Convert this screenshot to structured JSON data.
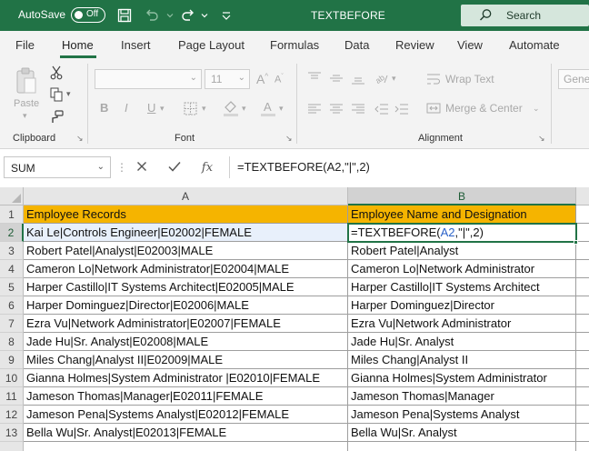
{
  "titlebar": {
    "autosave_label": "AutoSave",
    "autosave_state": "Off",
    "document_title": "TEXTBEFORE",
    "search_placeholder": "Search"
  },
  "ribbon_tabs": [
    "File",
    "Home",
    "Insert",
    "Page Layout",
    "Formulas",
    "Data",
    "Review",
    "View",
    "Automate"
  ],
  "active_tab": "Home",
  "ribbon": {
    "clipboard": {
      "label": "Clipboard",
      "paste_label": "Paste"
    },
    "font": {
      "label": "Font",
      "size": "11",
      "bold": "B",
      "italic": "I",
      "underline": "U"
    },
    "alignment": {
      "label": "Alignment",
      "wrap_text": "Wrap Text",
      "merge_center": "Merge & Center"
    },
    "number": {
      "format": "Genera"
    }
  },
  "formula_bar": {
    "name_box": "SUM",
    "cancel_icon": "x-icon",
    "enter_icon": "check-icon",
    "fx_label": "fx",
    "formula": "=TEXTBEFORE(A2,\"|\",2)"
  },
  "grid": {
    "columns": [
      "A",
      "B"
    ],
    "rows": [
      {
        "num": "1",
        "a": "Employee Records",
        "b": "Employee Name and Designation"
      },
      {
        "num": "2",
        "a": "Kai Le|Controls Engineer|E02002|FEMALE",
        "b_prefix": "=TEXTBEFORE(",
        "b_ref": "A2",
        "b_suffix": ",\"|\",2)"
      },
      {
        "num": "3",
        "a": "Robert Patel|Analyst|E02003|MALE",
        "b": "Robert Patel|Analyst"
      },
      {
        "num": "4",
        "a": "Cameron Lo|Network Administrator|E02004|MALE",
        "b": "Cameron Lo|Network Administrator"
      },
      {
        "num": "5",
        "a": "Harper Castillo|IT Systems Architect|E02005|MALE",
        "b": "Harper Castillo|IT Systems Architect"
      },
      {
        "num": "6",
        "a": "Harper Dominguez|Director|E02006|MALE",
        "b": "Harper Dominguez|Director"
      },
      {
        "num": "7",
        "a": "Ezra Vu|Network Administrator|E02007|FEMALE",
        "b": "Ezra Vu|Network Administrator"
      },
      {
        "num": "8",
        "a": "Jade Hu|Sr. Analyst|E02008|MALE",
        "b": "Jade Hu|Sr. Analyst"
      },
      {
        "num": "9",
        "a": "Miles Chang|Analyst II|E02009|MALE",
        "b": "Miles Chang|Analyst II"
      },
      {
        "num": "10",
        "a": "Gianna Holmes|System Administrator |E02010|FEMALE",
        "b": "Gianna Holmes|System Administrator"
      },
      {
        "num": "11",
        "a": "Jameson Thomas|Manager|E02011|FEMALE",
        "b": "Jameson Thomas|Manager"
      },
      {
        "num": "12",
        "a": "Jameson Pena|Systems Analyst|E02012|FEMALE",
        "b": "Jameson Pena|Systems Analyst"
      },
      {
        "num": "13",
        "a": "Bella Wu|Sr. Analyst|E02013|FEMALE",
        "b": "Bella Wu|Sr. Analyst"
      }
    ]
  },
  "colors": {
    "excel_green": "#217346",
    "header_fill": "#f5b400",
    "formula_reference": "#2a62c9"
  }
}
